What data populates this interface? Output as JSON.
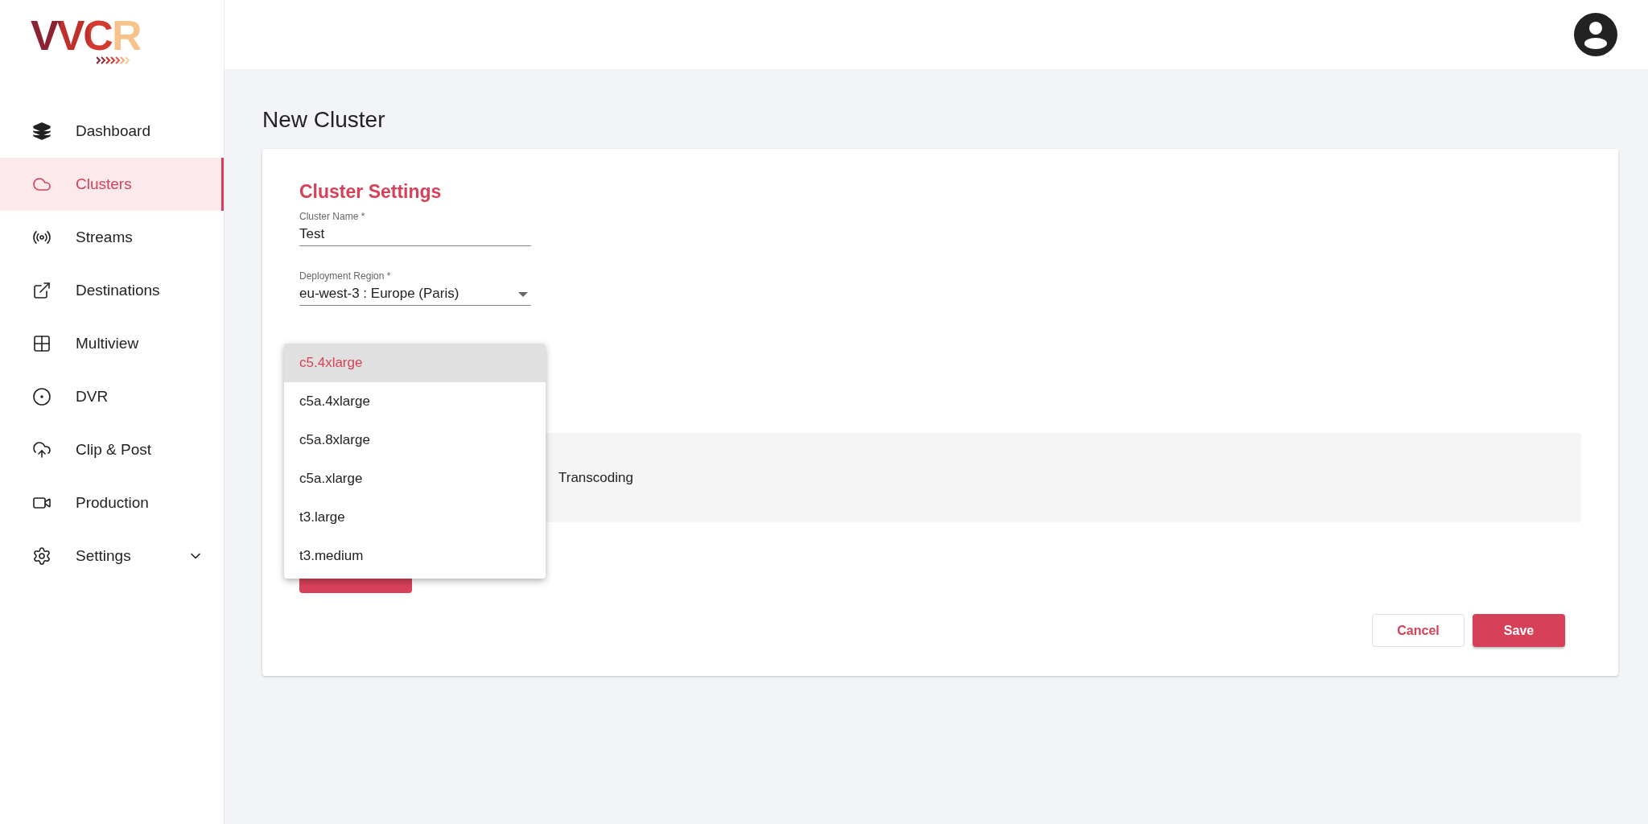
{
  "logo": {
    "text": "VVCR"
  },
  "nav": [
    {
      "label": "Dashboard",
      "selected": false,
      "expandable": false
    },
    {
      "label": "Clusters",
      "selected": true,
      "expandable": false
    },
    {
      "label": "Streams",
      "selected": false,
      "expandable": false
    },
    {
      "label": "Destinations",
      "selected": false,
      "expandable": false
    },
    {
      "label": "Multiview",
      "selected": false,
      "expandable": false
    },
    {
      "label": "DVR",
      "selected": false,
      "expandable": false
    },
    {
      "label": "Clip & Post",
      "selected": false,
      "expandable": false
    },
    {
      "label": "Production",
      "selected": false,
      "expandable": false
    },
    {
      "label": "Settings",
      "selected": false,
      "expandable": true
    }
  ],
  "page": {
    "title": "New Cluster"
  },
  "form": {
    "section_title": "Cluster Settings",
    "fields": [
      {
        "label": "Cluster Name *",
        "value": "Test",
        "kind": "text"
      },
      {
        "label": "Deployment Region *",
        "value": "eu-west-3 : Europe (Paris)",
        "kind": "select"
      }
    ],
    "dropdown": {
      "options": [
        {
          "label": "c5.4xlarge",
          "selected": true
        },
        {
          "label": "c5a.4xlarge",
          "selected": false
        },
        {
          "label": "c5a.8xlarge",
          "selected": false
        },
        {
          "label": "c5a.xlarge",
          "selected": false
        },
        {
          "label": "t3.large",
          "selected": false
        },
        {
          "label": "t3.medium",
          "selected": false
        }
      ]
    },
    "transcoding_panel": {
      "text": "Transcoding"
    },
    "buttons": [
      {
        "label": "Cancel",
        "kind": "secondary"
      },
      {
        "label": "Save",
        "kind": "primary"
      }
    ]
  }
}
